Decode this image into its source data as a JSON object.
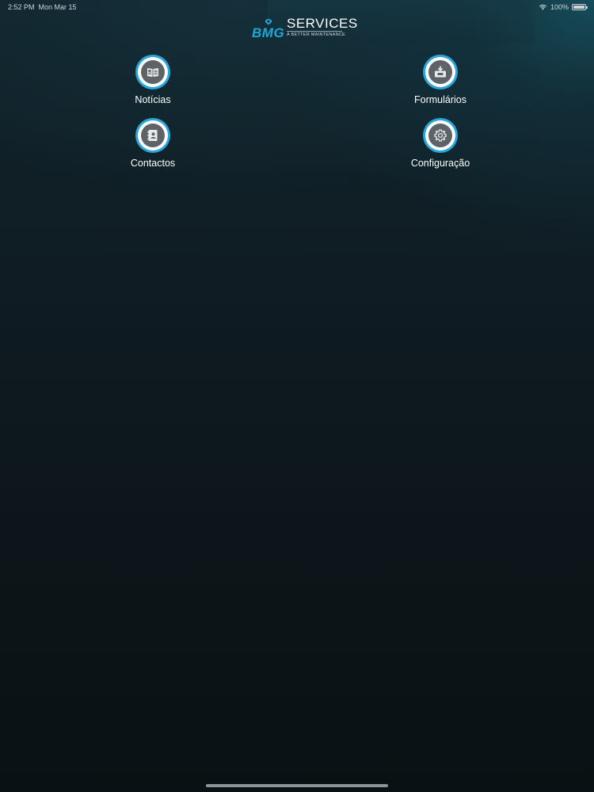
{
  "status_bar": {
    "time": "2:52 PM",
    "date": "Mon Mar 15",
    "battery_percent": "100%",
    "wifi_icon": "wifi-icon",
    "battery_icon": "battery-icon"
  },
  "logo": {
    "brand": "BMG",
    "services": "SERVICES",
    "tagline": "A BETTER MAINTENANCE"
  },
  "colors": {
    "accent": "#2aa6dd",
    "icon_core": "#5e6367"
  },
  "menu": [
    {
      "label": "Notícias",
      "icon": "newspaper-icon"
    },
    {
      "label": "Formulários",
      "icon": "form-inbox-icon"
    },
    {
      "label": "Contactos",
      "icon": "address-book-icon"
    },
    {
      "label": "Configuração",
      "icon": "gear-icon"
    }
  ]
}
